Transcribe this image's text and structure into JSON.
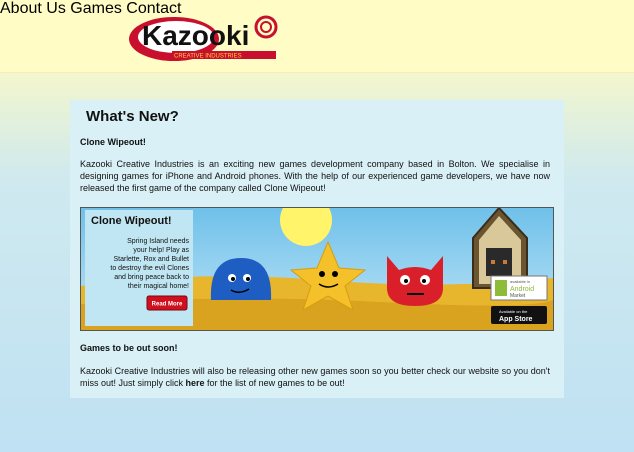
{
  "brand": {
    "logo_text": "Kazooki",
    "logo_tagline": "CREATIVE INDUSTRIES"
  },
  "nav": {
    "items": [
      {
        "label": "About Us"
      },
      {
        "label": "Games"
      },
      {
        "label": "Contact"
      }
    ]
  },
  "main": {
    "heading": "What's New?",
    "section1_title": "Clone Wipeout!",
    "section1_text": "Kazooki Creative Industries is an exciting new games development company based in Bolton. We specialise in designing games for iPhone and Android phones. With the help of our experienced game developers, we have now released the first game of the company called Clone Wipeout!",
    "section2_title": "Games to be out soon!",
    "section2_text_before": "Kazooki Creative Industries will also be releasing other new games soon so you better check our website so you don't miss out! Just simply click ",
    "section2_link": "here",
    "section2_text_after": " for the list of new games to be out!"
  },
  "banner": {
    "title": "Clone Wipeout!",
    "blurb_lines": [
      "Spring Island needs",
      "your help! Play as",
      "Starlette, Rox and Bullet",
      "to destroy the evil Clones",
      "and bring peace back to",
      "their magical home!"
    ],
    "read_more": "Read More",
    "android_badge_top": "available in",
    "android_badge": "Android",
    "android_badge_bottom": "Market",
    "appstore_badge_top": "Available on the",
    "appstore_badge": "App Store"
  },
  "colors": {
    "accent_red": "#c8102e",
    "panel_bg": "#d9f0f6"
  }
}
